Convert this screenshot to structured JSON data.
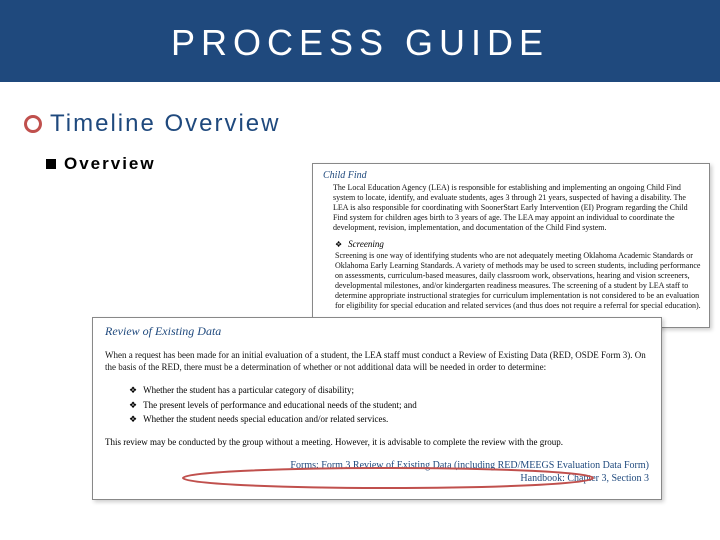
{
  "header": {
    "title": "PROCESS GUIDE"
  },
  "content": {
    "timeline_title": "Timeline Overview",
    "overview_label": "Overview"
  },
  "snippet1": {
    "heading": "Child Find",
    "body": "The Local Education Agency (LEA) is responsible for establishing and implementing an ongoing Child Find system to locate, identify, and evaluate students, ages 3 through 21 years, suspected of having a disability. The LEA is also responsible for coordinating with SoonerStart Early Intervention (EI) Program regarding the Child Find system for children ages birth to 3 years of age. The LEA may appoint an individual to coordinate the development, revision, implementation, and documentation of the Child Find system.",
    "sub_title": "Screening",
    "sub_body": "Screening is one way of identifying students who are not adequately meeting Oklahoma Academic Standards or Oklahoma Early Learning Standards. A variety of methods may be used to screen students, including performance on assessments, curriculum-based measures, daily classroom work, observations, hearing and vision screeners, developmental milestones, and/or kindergarten readiness measures. The screening of a student by LEA staff to determine appropriate instructional strategies for curriculum implementation is not considered to be an evaluation for eligibility for special education and related services (and thus does not require a referral for special education)."
  },
  "snippet2": {
    "heading": "Review of Existing Data",
    "intro": "When a request has been made for an initial evaluation of a student, the LEA staff must conduct a Review of Existing Data (RED, OSDE Form 3). On the basis of the RED, there must be a determination of whether or not additional data will be needed in order to determine:",
    "bullets": [
      "Whether the student has a particular category of disability;",
      "The present levels of performance and educational needs of the student; and",
      "Whether the student needs special education and/or related services."
    ],
    "footer": "This review may be conducted by the group without a meeting. However, it is advisable to complete the review with the group.",
    "forms_line": "Forms: Form 3   Review of Existing Data (including RED/MEEGS Evaluation Data Form)",
    "handbook_line": "Handbook: Chapter 3, Section 3"
  }
}
